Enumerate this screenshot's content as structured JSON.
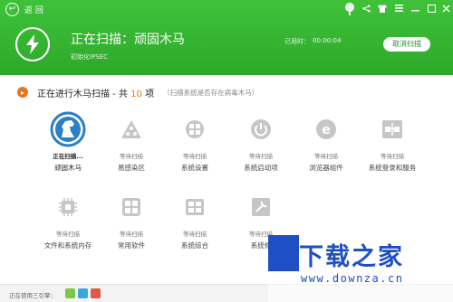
{
  "colors": {
    "header_green": "#2ea82a",
    "accent_orange": "#e8731e",
    "active_blue": "#2a7fc7",
    "watermark_blue": "#1e4fc4"
  },
  "topbar": {
    "back_label": "返 回"
  },
  "header": {
    "title": "正在扫描：顽固木马",
    "subtitle": "初始化IPSEC",
    "elapsed_label": "已用时：",
    "elapsed_value": "00:00:04",
    "cancel_label": "取消扫描"
  },
  "status": {
    "text_prefix": "正在进行木马扫描 - 共 ",
    "count": "10",
    "text_suffix": " 项",
    "hint": "（扫描系统是否存在病毒木马）"
  },
  "items": [
    {
      "status": "正在扫描...",
      "name": "顽固木马",
      "icon": "horse-icon",
      "active": true
    },
    {
      "status": "等待扫描",
      "name": "易感染区",
      "icon": "warning-triangle-icon"
    },
    {
      "status": "等待扫描",
      "name": "系统设置",
      "icon": "windows-gear-icon"
    },
    {
      "status": "等待扫描",
      "name": "系统启动项",
      "icon": "power-icon"
    },
    {
      "status": "等待扫描",
      "name": "浏览器组件",
      "icon": "browser-e-icon"
    },
    {
      "status": "等待扫描",
      "name": "系统登录和服务",
      "icon": "network-service-icon"
    },
    {
      "status": "等待扫描",
      "name": "文件和系统内存",
      "icon": "memory-chip-icon"
    },
    {
      "status": "等待扫描",
      "name": "常用软件",
      "icon": "software-grid-icon"
    },
    {
      "status": "等待扫描",
      "name": "系统综合",
      "icon": "windows-logo-icon"
    },
    {
      "status": "等待扫描",
      "name": "系统修",
      "icon": "repair-icon"
    }
  ],
  "footer": {
    "engine_label": "正在使用三引擎："
  },
  "watermark": {
    "main": "下载之家",
    "url": "www.downza.cn"
  }
}
